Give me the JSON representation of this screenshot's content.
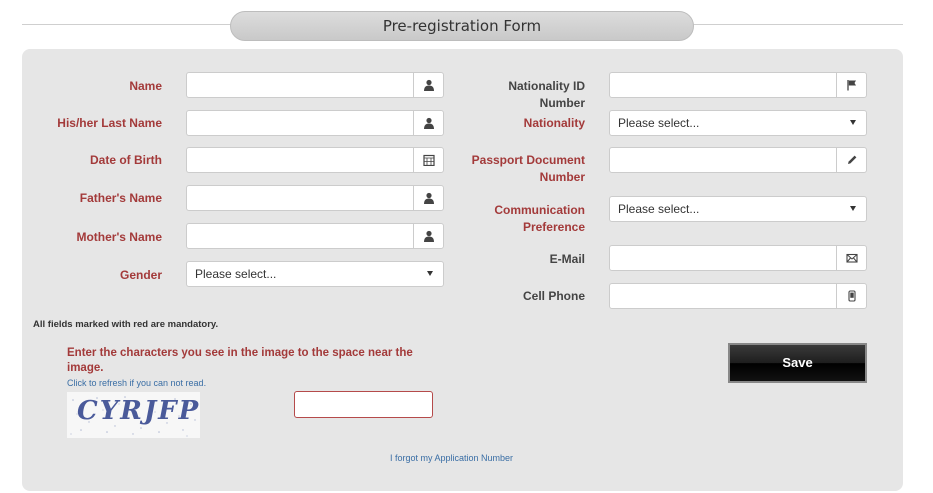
{
  "header": {
    "title": "Pre-registration Form"
  },
  "left_fields": [
    {
      "label": "Name",
      "value": "",
      "icon": "user-icon"
    },
    {
      "label": "His/her Last Name",
      "value": "",
      "icon": "user-icon"
    },
    {
      "label": "Date of Birth",
      "value": "",
      "icon": "calendar-icon"
    },
    {
      "label": "Father's Name",
      "value": "",
      "icon": "user-icon"
    },
    {
      "label": "Mother's Name",
      "value": "",
      "icon": "user-icon"
    }
  ],
  "gender": {
    "label": "Gender",
    "selected": "Please select..."
  },
  "right_fields": {
    "nationality_id": {
      "label": "Nationality ID Number",
      "value": "",
      "icon": "flag-icon"
    },
    "nationality": {
      "label": "Nationality",
      "selected": "Please select..."
    },
    "passport": {
      "label_line1": "Passport Document",
      "label_line2": "Number",
      "value": "",
      "icon": "pencil-icon"
    },
    "communication": {
      "label_line1": "Communication",
      "label_line2": "Preference",
      "selected": "Please select..."
    },
    "email": {
      "label": "E-Mail",
      "value": "",
      "icon": "envelope-icon"
    },
    "cell": {
      "label": "Cell Phone",
      "value": "",
      "icon": "phone-icon"
    }
  },
  "mandatory_note": "All fields marked with red are mandatory.",
  "captcha": {
    "instruction_line1": "Enter the characters you see in the image to the space near the",
    "instruction_line2": "image.",
    "refresh_text": "Click to refresh if you can not read.",
    "image_text": "CYRJFP",
    "input_value": ""
  },
  "save_label": "Save",
  "forgot_link": "I forgot my Application Number",
  "colors": {
    "mandatory_label": "#a33a3a",
    "link": "#3a6ea5",
    "panel_bg": "#e6e6e6",
    "button_bg": "#000000"
  }
}
